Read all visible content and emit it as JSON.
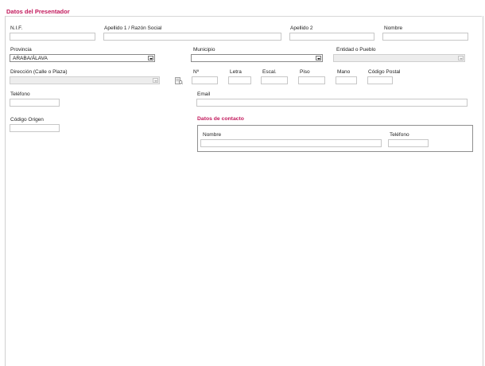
{
  "section": {
    "title": "Datos del Presentador"
  },
  "fields": {
    "nif": {
      "label": "N.I.F.",
      "value": ""
    },
    "apellido1": {
      "label": "Apellido 1 / Razón Social",
      "value": ""
    },
    "apellido2": {
      "label": "Apellido 2",
      "value": ""
    },
    "nombre": {
      "label": "Nombre",
      "value": ""
    },
    "provincia": {
      "label": "Provincia",
      "value": "ARABA/ÁLAVA"
    },
    "municipio": {
      "label": "Municipio",
      "value": ""
    },
    "entidad": {
      "label": "Entidad o Pueblo",
      "value": ""
    },
    "direccion": {
      "label": "Dirección (Calle o Plaza)",
      "value": ""
    },
    "numero": {
      "label": "Nº",
      "value": ""
    },
    "letra": {
      "label": "Letra",
      "value": ""
    },
    "escalera": {
      "label": "Escal.",
      "value": ""
    },
    "piso": {
      "label": "Piso",
      "value": ""
    },
    "mano": {
      "label": "Mano",
      "value": ""
    },
    "codigo_postal": {
      "label": "Código Postal",
      "value": ""
    },
    "telefono": {
      "label": "Teléfono",
      "value": ""
    },
    "email": {
      "label": "Email",
      "value": ""
    },
    "codigo_origen": {
      "label": "Código Origen",
      "value": ""
    }
  },
  "contacto": {
    "title": "Datos de contacto",
    "nombre": {
      "label": "Nombre",
      "value": ""
    },
    "telefono": {
      "label": "Teléfono",
      "value": ""
    }
  },
  "icons": {
    "address_search": "address-lookup-icon"
  },
  "colors": {
    "accent": "#c2185b"
  }
}
